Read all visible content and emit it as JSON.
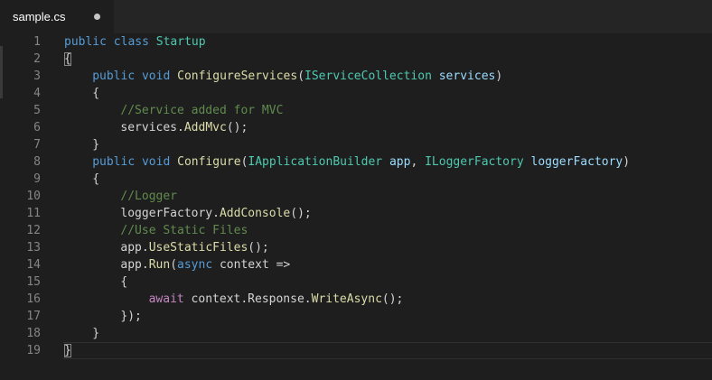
{
  "tab": {
    "label": "sample.cs",
    "dirty": true
  },
  "colors": {
    "keyword": "#569cd6",
    "type": "#4ec9b0",
    "function": "#dcdcaa",
    "parameter": "#9cdcfe",
    "comment": "#608b4e",
    "control": "#c586c0",
    "plain": "#d4d4d4"
  },
  "lines": [
    {
      "n": "1",
      "indent": 0,
      "tokens": [
        [
          "kw",
          "public"
        ],
        [
          "pl",
          " "
        ],
        [
          "kw",
          "class"
        ],
        [
          "pl",
          " "
        ],
        [
          "ty",
          "Startup"
        ]
      ]
    },
    {
      "n": "2",
      "indent": 0,
      "tokens": [
        [
          "pl",
          "{"
        ]
      ]
    },
    {
      "n": "3",
      "indent": 1,
      "tokens": [
        [
          "kw",
          "public"
        ],
        [
          "pl",
          " "
        ],
        [
          "kw",
          "void"
        ],
        [
          "pl",
          " "
        ],
        [
          "fn",
          "ConfigureServices"
        ],
        [
          "pl",
          "("
        ],
        [
          "ty",
          "IServiceCollection"
        ],
        [
          "pl",
          " "
        ],
        [
          "pa",
          "services"
        ],
        [
          "pl",
          ")"
        ]
      ]
    },
    {
      "n": "4",
      "indent": 1,
      "tokens": [
        [
          "pl",
          "{"
        ]
      ]
    },
    {
      "n": "5",
      "indent": 2,
      "tokens": [
        [
          "cm",
          "//Service added for MVC"
        ]
      ]
    },
    {
      "n": "6",
      "indent": 2,
      "tokens": [
        [
          "pl",
          "services."
        ],
        [
          "fn",
          "AddMvc"
        ],
        [
          "pl",
          "();"
        ]
      ]
    },
    {
      "n": "7",
      "indent": 1,
      "tokens": [
        [
          "pl",
          "}"
        ]
      ]
    },
    {
      "n": "8",
      "indent": 1,
      "tokens": [
        [
          "kw",
          "public"
        ],
        [
          "pl",
          " "
        ],
        [
          "kw",
          "void"
        ],
        [
          "pl",
          " "
        ],
        [
          "fn",
          "Configure"
        ],
        [
          "pl",
          "("
        ],
        [
          "ty",
          "IApplicationBuilder"
        ],
        [
          "pl",
          " "
        ],
        [
          "pa",
          "app"
        ],
        [
          "pl",
          ", "
        ],
        [
          "ty",
          "ILoggerFactory"
        ],
        [
          "pl",
          " "
        ],
        [
          "pa",
          "loggerFactory"
        ],
        [
          "pl",
          ")"
        ]
      ]
    },
    {
      "n": "9",
      "indent": 1,
      "tokens": [
        [
          "pl",
          "{"
        ]
      ]
    },
    {
      "n": "10",
      "indent": 2,
      "tokens": [
        [
          "cm",
          "//Logger"
        ]
      ]
    },
    {
      "n": "11",
      "indent": 2,
      "tokens": [
        [
          "pl",
          "loggerFactory."
        ],
        [
          "fn",
          "AddConsole"
        ],
        [
          "pl",
          "();"
        ]
      ]
    },
    {
      "n": "12",
      "indent": 2,
      "tokens": [
        [
          "cm",
          "//Use Static Files"
        ]
      ]
    },
    {
      "n": "13",
      "indent": 2,
      "tokens": [
        [
          "pl",
          "app."
        ],
        [
          "fn",
          "UseStaticFiles"
        ],
        [
          "pl",
          "();"
        ]
      ]
    },
    {
      "n": "14",
      "indent": 2,
      "tokens": [
        [
          "pl",
          "app."
        ],
        [
          "fn",
          "Run"
        ],
        [
          "pl",
          "("
        ],
        [
          "kw",
          "async"
        ],
        [
          "pl",
          " context =>"
        ]
      ]
    },
    {
      "n": "15",
      "indent": 2,
      "tokens": [
        [
          "pl",
          "{"
        ]
      ]
    },
    {
      "n": "16",
      "indent": 3,
      "tokens": [
        [
          "ctl",
          "await"
        ],
        [
          "pl",
          " context.Response."
        ],
        [
          "fn",
          "WriteAsync"
        ],
        [
          "pl",
          "();"
        ]
      ]
    },
    {
      "n": "17",
      "indent": 2,
      "tokens": [
        [
          "pl",
          "});"
        ]
      ]
    },
    {
      "n": "18",
      "indent": 1,
      "tokens": [
        [
          "pl",
          "}"
        ]
      ]
    },
    {
      "n": "19",
      "indent": 0,
      "tokens": [
        [
          "pl",
          "}"
        ]
      ],
      "current": true
    }
  ]
}
